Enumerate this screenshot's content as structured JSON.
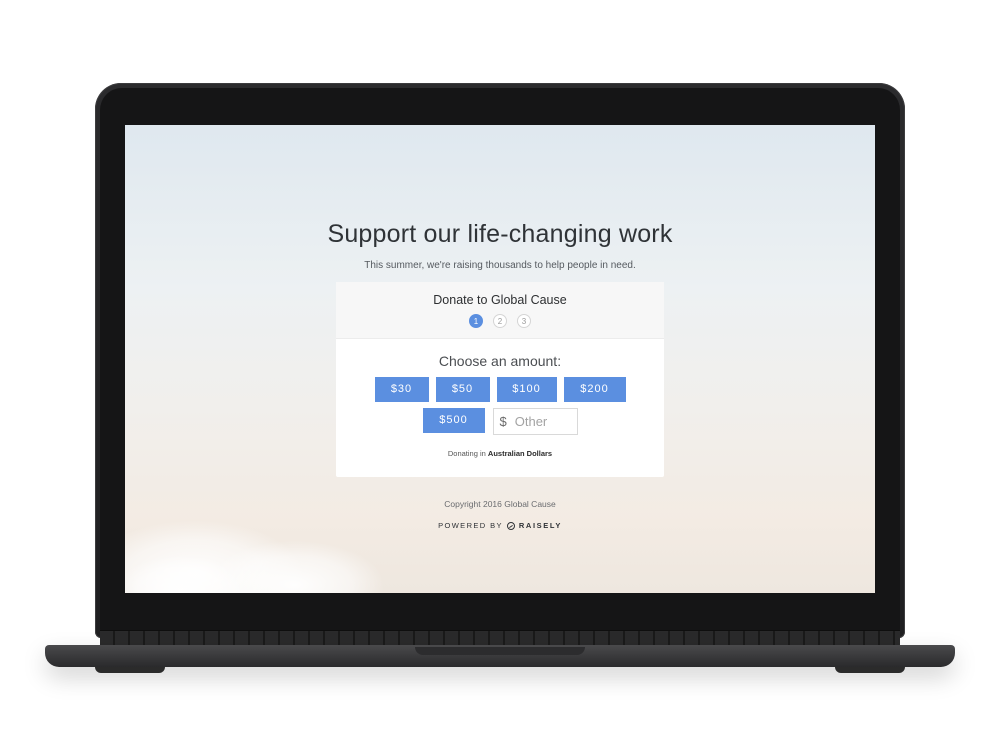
{
  "page": {
    "title": "Support our life-changing work",
    "subtitle": "This summer, we're raising thousands to help people in need."
  },
  "donation_card": {
    "title": "Donate to Global Cause",
    "steps": [
      "1",
      "2",
      "3"
    ],
    "active_step": "1",
    "choose_label": "Choose an amount:",
    "amounts": [
      "$30",
      "$50",
      "$100",
      "$200",
      "$500"
    ],
    "other": {
      "symbol": "$",
      "placeholder": "Other",
      "value": ""
    },
    "currency_prefix": "Donating in",
    "currency": "Australian Dollars"
  },
  "footer": {
    "copyright": "Copyright 2016 Global Cause",
    "powered_by": "POWERED BY",
    "brand": "RAISELY"
  },
  "colors": {
    "accent": "#5b8fe0",
    "title_text": "#2f3337",
    "laptop_frame": "#1f1f21"
  }
}
